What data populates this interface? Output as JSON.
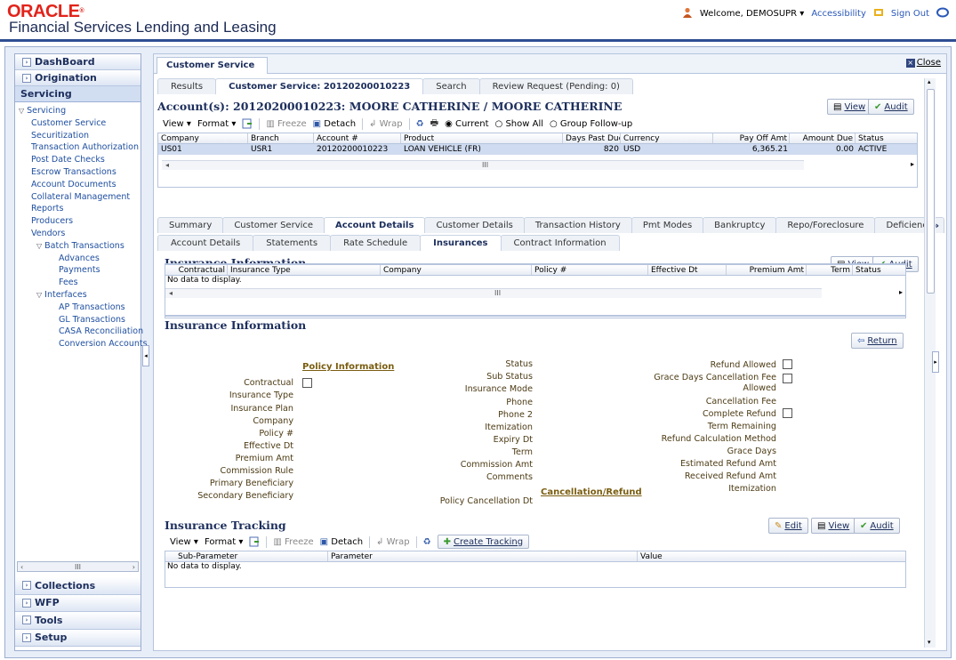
{
  "header": {
    "brand_oracle": "ORACLE",
    "app_title": "Financial Services Lending and Leasing",
    "welcome": "Welcome, DEMOSUPR",
    "accessibility": "Accessibility",
    "sign_out": "Sign Out"
  },
  "sidebar": {
    "top_sections": [
      "DashBoard",
      "Origination",
      "Servicing"
    ],
    "items": [
      {
        "label": "Servicing",
        "level": 1,
        "tri": "▽"
      },
      {
        "label": "Customer Service",
        "level": 2
      },
      {
        "label": "Securitization",
        "level": 2
      },
      {
        "label": "Transaction Authorization",
        "level": 2
      },
      {
        "label": "Post Date Checks",
        "level": 2
      },
      {
        "label": "Escrow Transactions",
        "level": 2
      },
      {
        "label": "Account Documents",
        "level": 2
      },
      {
        "label": "Collateral Management",
        "level": 2
      },
      {
        "label": "Reports",
        "level": 2
      },
      {
        "label": "Producers",
        "level": 2
      },
      {
        "label": "Vendors",
        "level": 2
      },
      {
        "label": "Batch Transactions",
        "level": 3,
        "tri": "▽"
      },
      {
        "label": "Advances",
        "level": 4
      },
      {
        "label": "Payments",
        "level": 4
      },
      {
        "label": "Fees",
        "level": 4
      },
      {
        "label": "Interfaces",
        "level": 3,
        "tri": "▽"
      },
      {
        "label": "AP Transactions",
        "level": 4
      },
      {
        "label": "GL Transactions",
        "level": 4
      },
      {
        "label": "CASA Reconciliation",
        "level": 4
      },
      {
        "label": "Conversion Accounts",
        "level": 4
      }
    ],
    "scroll_label": "III",
    "bottom_sections": [
      "Collections",
      "WFP",
      "Tools",
      "Setup"
    ]
  },
  "main": {
    "tab_label": "Customer Service",
    "close_label": "Close",
    "subtabs": [
      "Results",
      "Customer Service: 20120200010223",
      "Search",
      "Review Request (Pending: 0)"
    ],
    "account_title": "Account(s): 20120200010223: MOORE CATHERINE / MOORE CATHERINE",
    "view_label": "View",
    "audit_label": "Audit",
    "edit_label": "Edit",
    "return_label": "Return",
    "toolbar": {
      "view": "View",
      "format": "Format",
      "freeze": "Freeze",
      "detach": "Detach",
      "wrap": "Wrap",
      "current": "Current",
      "show_all": "Show All",
      "group_followup": "Group Follow-up",
      "create_tracking": "Create Tracking"
    },
    "account_grid": {
      "headers": [
        "Company",
        "Branch",
        "Account #",
        "Product",
        "Days Past Due",
        "Currency",
        "Pay Off Amt",
        "Amount Due",
        "Status"
      ],
      "row": [
        "US01",
        "USR1",
        "20120200010223",
        "LOAN VEHICLE (FR)",
        "820",
        "USD",
        "6,365.21",
        "0.00",
        "ACTIVE"
      ]
    },
    "account_tabs": [
      "Summary",
      "Customer Service",
      "Account Details",
      "Customer Details",
      "Transaction History",
      "Pmt Modes",
      "Bankruptcy",
      "Repo/Foreclosure",
      "Deficiency"
    ],
    "more_tabs": "»",
    "detail_tabs": [
      "Account Details",
      "Statements",
      "Rate Schedule",
      "Insurances",
      "Contract Information"
    ],
    "insurance_info_title": "Insurance Information",
    "insurance_grid": {
      "headers": [
        "Contractual",
        "Insurance Type",
        "Company",
        "Policy #",
        "Effective Dt",
        "Premium Amt",
        "Term",
        "Status"
      ],
      "nodata": "No data to display."
    },
    "insurance_detail_title": "Insurance Information",
    "policy_info_link": "Policy Information",
    "cancellation_link": "Cancellation/Refund",
    "col1_labels": [
      "Contractual",
      "Insurance Type",
      "Insurance Plan",
      "Company",
      "Policy #",
      "Effective Dt",
      "Premium Amt",
      "Commission Rule",
      "Primary Beneficiary",
      "Secondary Beneficiary"
    ],
    "col2_labels": [
      "Status",
      "Sub Status",
      "Insurance Mode",
      "Phone",
      "Phone 2",
      "Itemization",
      "Expiry Dt",
      "Term",
      "Commission Amt",
      "Comments",
      "Policy Cancellation Dt"
    ],
    "col3_labels": [
      "Refund Allowed",
      "Grace Days Cancellation Fee",
      "Allowed",
      "Cancellation Fee",
      "Complete Refund",
      "Term Remaining",
      "Refund Calculation Method",
      "Grace Days",
      "Estimated Refund Amt",
      "Received Refund Amt",
      "Itemization"
    ],
    "tracking_title": "Insurance Tracking",
    "tracking_grid": {
      "headers": [
        "Sub-Parameter",
        "Parameter",
        "Value"
      ],
      "nodata": "No data to display."
    }
  }
}
